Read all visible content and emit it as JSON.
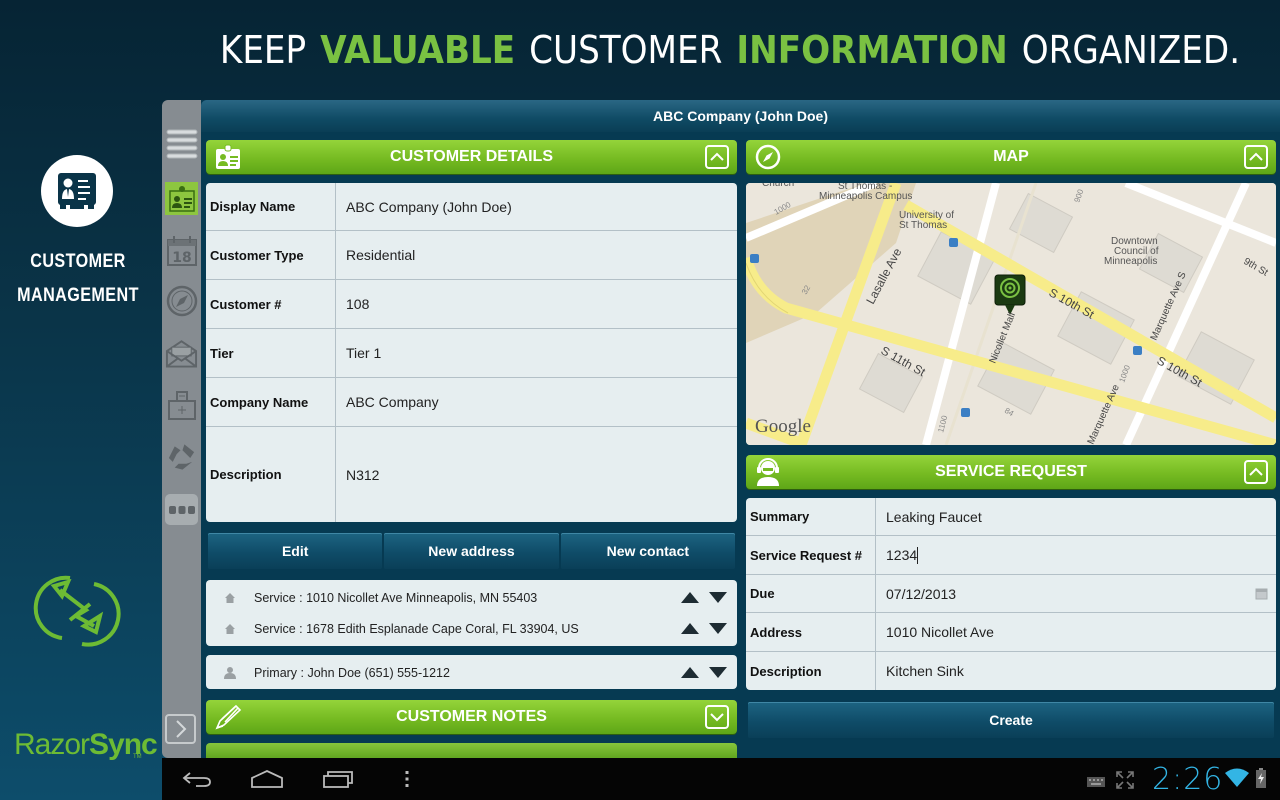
{
  "banner": {
    "parts": [
      {
        "text": "KEEP",
        "style": "white"
      },
      {
        "text": "VALUABLE",
        "style": "green"
      },
      {
        "text": "CUSTOMER",
        "style": "white"
      },
      {
        "text": "INFORMATION",
        "style": "green"
      },
      {
        "text": "ORGANIZED.",
        "style": "white"
      }
    ]
  },
  "promo": {
    "icon": "customer-card-icon",
    "title_line1": "CUSTOMER",
    "title_line2": "MANAGEMENT",
    "brand_light": "Razor",
    "brand_bold": "Sync",
    "trademark": "TM"
  },
  "rail": {
    "items": [
      {
        "name": "menu",
        "icon": "menu-lines-icon"
      },
      {
        "name": "customers",
        "icon": "customer-card-icon",
        "active": true
      },
      {
        "name": "calendar",
        "icon": "calendar-icon",
        "label": "18"
      },
      {
        "name": "map",
        "icon": "compass-icon"
      },
      {
        "name": "mail",
        "icon": "envelope-icon"
      },
      {
        "name": "inventory",
        "icon": "toolbox-icon"
      },
      {
        "name": "sync",
        "icon": "sync-icon"
      },
      {
        "name": "more",
        "icon": "more-dots-icon"
      }
    ],
    "expand_icon": "chevron-right-icon"
  },
  "app": {
    "title": "ABC Company (John Doe)"
  },
  "customer_details": {
    "header": "CUSTOMER DETAILS",
    "rows": [
      {
        "label": "Display Name",
        "value": "ABC Company (John Doe)"
      },
      {
        "label": "Customer Type",
        "value": "Residential"
      },
      {
        "label": "Customer #",
        "value": "108"
      },
      {
        "label": "Tier",
        "value": "Tier 1"
      },
      {
        "label": "Company Name",
        "value": "ABC Company"
      },
      {
        "label": "Description",
        "value": "N312"
      }
    ],
    "buttons": {
      "edit": "Edit",
      "new_address": "New address",
      "new_contact": "New contact"
    },
    "addresses": [
      {
        "text": "Service : 1010 Nicollet Ave Minneapolis, MN 55403"
      },
      {
        "text": "Service : 1678 Edith Esplanade Cape Coral, FL 33904, US"
      }
    ],
    "contacts": [
      {
        "text": "Primary : John Doe (651) 555-1212"
      }
    ]
  },
  "customer_notes": {
    "header": "CUSTOMER NOTES"
  },
  "map": {
    "header": "MAP",
    "labels": {
      "church": "Church",
      "campus1": "St Thomas -",
      "campus2": "Minneapolis Campus",
      "univ1": "University of",
      "univ2": "St Thomas",
      "dtc1": "Downtown",
      "dtc2": "Council of",
      "dtc3": "Minneapolis",
      "lasalle": "Lasalle Ave",
      "s10a": "S 10th St",
      "s10b": "S 10th St",
      "s11": "S 11th St",
      "nicollet": "Nicollet Mall",
      "marquette": "Marquette Ave S",
      "marquette2": "Marquette Ave",
      "ninth": "9th St",
      "n1000": "1000",
      "n1000b": "1000",
      "n32": "32",
      "n84": "84",
      "n1100": "1100",
      "n900": "900",
      "google": "Google"
    }
  },
  "service_request": {
    "header": "SERVICE REQUEST",
    "rows": [
      {
        "label": "Summary",
        "value": "Leaking Faucet"
      },
      {
        "label": "Service Request #",
        "value": "1234"
      },
      {
        "label": "Due",
        "value": "07/12/2013"
      },
      {
        "label": "Address",
        "value": "1010 Nicollet Ave"
      },
      {
        "label": "Description",
        "value": "Kitchen Sink"
      }
    ],
    "create_label": "Create"
  },
  "system_bar": {
    "time": "2:26"
  },
  "colors": {
    "accent_green": "#7ac142",
    "header_green": "#76bb22",
    "navy": "#063a52",
    "clock_blue": "#33b5e5"
  }
}
